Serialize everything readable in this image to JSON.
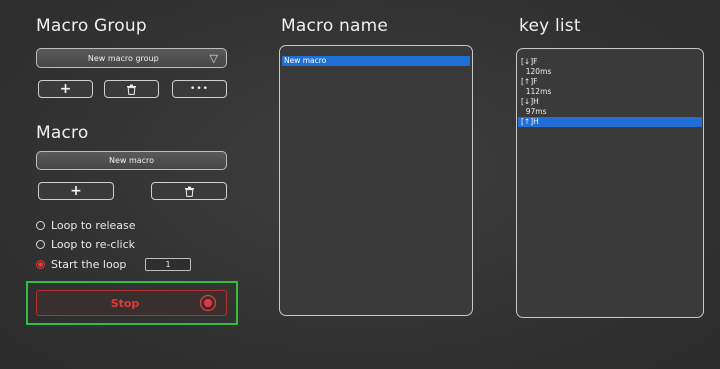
{
  "macro_group": {
    "title": "Macro Group",
    "selected_group": "New macro group",
    "add_icon": "plus-icon",
    "delete_icon": "trash-icon",
    "more_label": "•••"
  },
  "macro": {
    "title": "Macro",
    "current_macro": "New macro",
    "add_icon": "plus-icon",
    "delete_icon": "trash-icon"
  },
  "loop_options": [
    {
      "label": "Loop to release",
      "selected": false
    },
    {
      "label": "Loop to re-click",
      "selected": false
    },
    {
      "label": "Start the loop",
      "selected": true
    }
  ],
  "loop_count": "1",
  "stop_button": {
    "label": "Stop"
  },
  "macro_name_panel": {
    "title": "Macro name",
    "items": [
      "New macro"
    ],
    "selected_index": 0
  },
  "key_list_panel": {
    "title": "key list",
    "entries": [
      "[↓]F",
      "  120ms",
      "[↑]F",
      "  112ms",
      "[↓]H",
      "  97ms",
      "[↑]H"
    ],
    "selected_index": 6
  },
  "colors": {
    "highlight": "#1f6fd6",
    "stop_red": "#e23a3a",
    "focus_green": "#2fbf3a"
  }
}
